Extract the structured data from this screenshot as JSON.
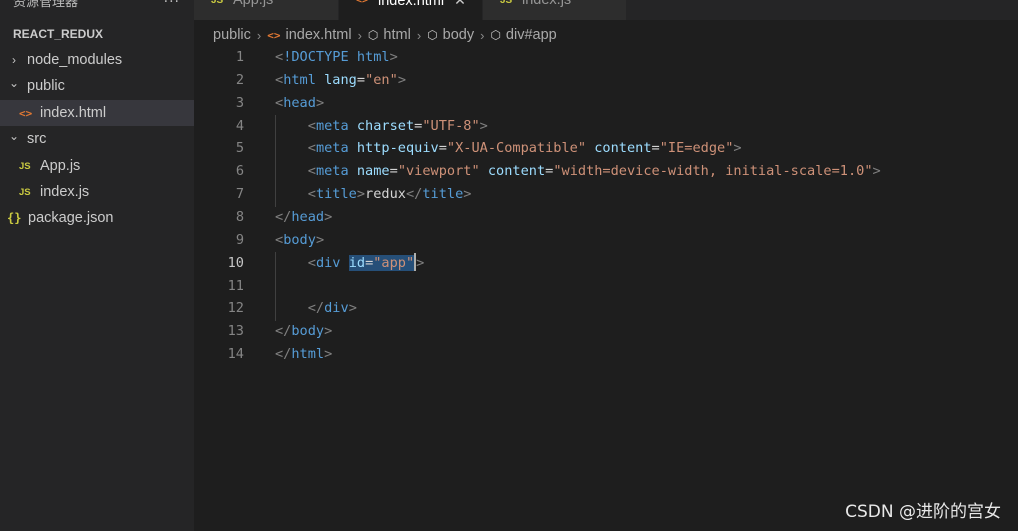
{
  "explorer": {
    "title": "资源管理器",
    "more": "···",
    "project": "REACT_REDUX",
    "tree": [
      {
        "label": "node_modules",
        "type": "folder",
        "expanded": false,
        "indent": 0
      },
      {
        "label": "public",
        "type": "folder",
        "expanded": true,
        "indent": 0
      },
      {
        "label": "index.html",
        "type": "html",
        "indent": 1,
        "selected": true
      },
      {
        "label": "src",
        "type": "folder",
        "expanded": true,
        "indent": 0
      },
      {
        "label": "App.js",
        "type": "js",
        "indent": 1
      },
      {
        "label": "index.js",
        "type": "js",
        "indent": 1
      },
      {
        "label": "package.json",
        "type": "json",
        "indent": 0
      }
    ]
  },
  "tabs": [
    {
      "label": "App.js",
      "type": "js",
      "active": false
    },
    {
      "label": "index.html",
      "type": "html",
      "active": true
    },
    {
      "label": "index.js",
      "type": "js",
      "active": false
    }
  ],
  "breadcrumb": {
    "folder": "public",
    "file": "index.html",
    "symbols": [
      "html",
      "body",
      "div#app"
    ]
  },
  "editor": {
    "current_line": 10,
    "lines": [
      {
        "n": "1",
        "tokens": [
          [
            "punc",
            "<"
          ],
          [
            "tag",
            "!DOCTYPE"
          ],
          [
            "text",
            " "
          ],
          [
            "tag",
            "html"
          ],
          [
            "punc",
            ">"
          ]
        ]
      },
      {
        "n": "2",
        "tokens": [
          [
            "punc",
            "<"
          ],
          [
            "tag",
            "html"
          ],
          [
            "text",
            " "
          ],
          [
            "attr",
            "lang"
          ],
          [
            "text",
            "="
          ],
          [
            "str",
            "\"en\""
          ],
          [
            "punc",
            ">"
          ]
        ]
      },
      {
        "n": "3",
        "tokens": [
          [
            "punc",
            "<"
          ],
          [
            "tag",
            "head"
          ],
          [
            "punc",
            ">"
          ]
        ]
      },
      {
        "n": "4",
        "tokens": [
          [
            "text",
            "    "
          ],
          [
            "punc",
            "<"
          ],
          [
            "tag",
            "meta"
          ],
          [
            "text",
            " "
          ],
          [
            "attr",
            "charset"
          ],
          [
            "text",
            "="
          ],
          [
            "str",
            "\"UTF-8\""
          ],
          [
            "punc",
            ">"
          ]
        ]
      },
      {
        "n": "5",
        "tokens": [
          [
            "text",
            "    "
          ],
          [
            "punc",
            "<"
          ],
          [
            "tag",
            "meta"
          ],
          [
            "text",
            " "
          ],
          [
            "attr",
            "http-equiv"
          ],
          [
            "text",
            "="
          ],
          [
            "str",
            "\"X-UA-Compatible\""
          ],
          [
            "text",
            " "
          ],
          [
            "attr",
            "content"
          ],
          [
            "text",
            "="
          ],
          [
            "str",
            "\"IE=edge\""
          ],
          [
            "punc",
            ">"
          ]
        ]
      },
      {
        "n": "6",
        "tokens": [
          [
            "text",
            "    "
          ],
          [
            "punc",
            "<"
          ],
          [
            "tag",
            "meta"
          ],
          [
            "text",
            " "
          ],
          [
            "attr",
            "name"
          ],
          [
            "text",
            "="
          ],
          [
            "str",
            "\"viewport\""
          ],
          [
            "text",
            " "
          ],
          [
            "attr",
            "content"
          ],
          [
            "text",
            "="
          ],
          [
            "str",
            "\"width=device-width, initial-scale=1.0\""
          ],
          [
            "punc",
            ">"
          ]
        ]
      },
      {
        "n": "7",
        "tokens": [
          [
            "text",
            "    "
          ],
          [
            "punc",
            "<"
          ],
          [
            "tag",
            "title"
          ],
          [
            "punc",
            ">"
          ],
          [
            "text",
            "redux"
          ],
          [
            "punc",
            "</"
          ],
          [
            "tag",
            "title"
          ],
          [
            "punc",
            ">"
          ]
        ]
      },
      {
        "n": "8",
        "tokens": [
          [
            "punc",
            "</"
          ],
          [
            "tag",
            "head"
          ],
          [
            "punc",
            ">"
          ]
        ]
      },
      {
        "n": "9",
        "tokens": [
          [
            "punc",
            "<"
          ],
          [
            "tag",
            "body"
          ],
          [
            "punc",
            ">"
          ]
        ]
      },
      {
        "n": "10",
        "tokens": [
          [
            "text",
            "    "
          ],
          [
            "punc",
            "<"
          ],
          [
            "tag",
            "div"
          ],
          [
            "text",
            " "
          ],
          [
            "attr-sel",
            "id"
          ],
          [
            "text-sel",
            "="
          ],
          [
            "str-sel",
            "\"app\""
          ],
          [
            "cursor",
            ""
          ],
          [
            "punc",
            ">"
          ]
        ]
      },
      {
        "n": "11",
        "tokens": []
      },
      {
        "n": "12",
        "tokens": [
          [
            "text",
            "    "
          ],
          [
            "punc",
            "</"
          ],
          [
            "tag",
            "div"
          ],
          [
            "punc",
            ">"
          ]
        ]
      },
      {
        "n": "13",
        "tokens": [
          [
            "punc",
            "</"
          ],
          [
            "tag",
            "body"
          ],
          [
            "punc",
            ">"
          ]
        ]
      },
      {
        "n": "14",
        "tokens": [
          [
            "punc",
            "</"
          ],
          [
            "tag",
            "html"
          ],
          [
            "punc",
            ">"
          ]
        ]
      }
    ]
  },
  "watermark": "CSDN @进阶的宫女"
}
